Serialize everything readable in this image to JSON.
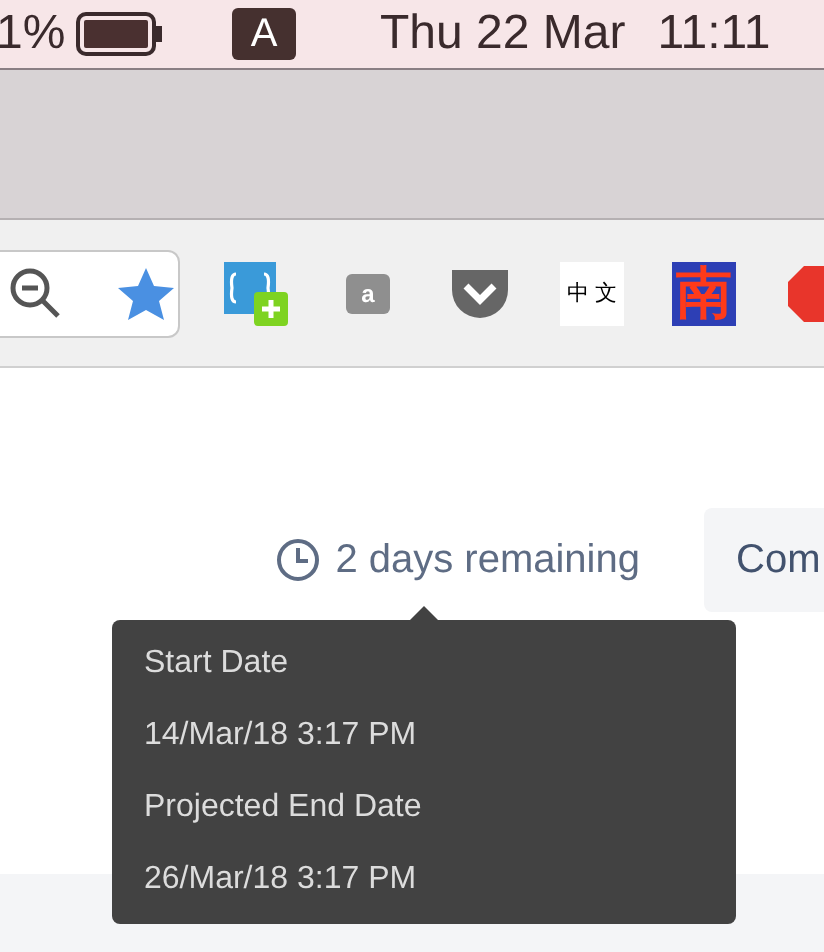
{
  "menu_bar": {
    "battery_percent": "1%",
    "input_source": "A",
    "date": "Thu 22 Mar",
    "time": "11:11"
  },
  "toolbar": {
    "extensions": [
      {
        "kind": "css"
      },
      {
        "kind": "chat",
        "label": "a"
      },
      {
        "kind": "pocket"
      },
      {
        "kind": "chinese",
        "label": "中 文"
      },
      {
        "kind": "nan",
        "label": "南"
      },
      {
        "kind": "stop"
      }
    ]
  },
  "content": {
    "remaining": "2 days remaining",
    "button": "Com",
    "tooltip": [
      {
        "label": "Start Date",
        "value": "14/Mar/18 3:17 PM"
      },
      {
        "label": "Projected End Date",
        "value": "26/Mar/18 3:17 PM"
      }
    ]
  }
}
